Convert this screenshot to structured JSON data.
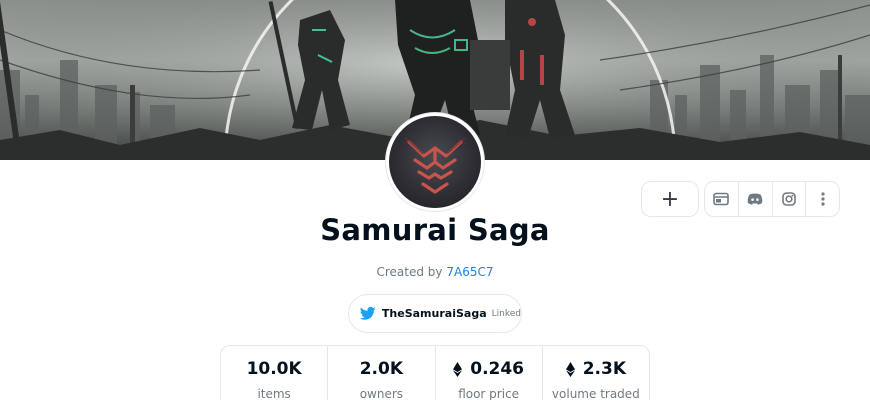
{
  "collection": {
    "title": "Samurai Saga",
    "created_by_label": "Created by",
    "creator": "7A65C7"
  },
  "twitter": {
    "handle": "TheSamuraiSaga",
    "status": "Linked",
    "icon": "twitter-bird-icon",
    "color": "#1da1f2"
  },
  "actions": {
    "add_symbol": "+",
    "social_icons": [
      "website-icon",
      "discord-icon",
      "instagram-icon",
      "more-options-icon"
    ]
  },
  "stats": [
    {
      "value": "10.0K",
      "label": "items",
      "currency": ""
    },
    {
      "value": "2.0K",
      "label": "owners",
      "currency": ""
    },
    {
      "value": "0.246",
      "label": "floor price",
      "currency": "eth-icon"
    },
    {
      "value": "2.3K",
      "label": "volume traded",
      "currency": "eth-icon"
    }
  ],
  "colors": {
    "text_primary": "#04111d",
    "text_secondary": "#707a83",
    "link": "#2081e2",
    "border": "#e5e8eb"
  }
}
